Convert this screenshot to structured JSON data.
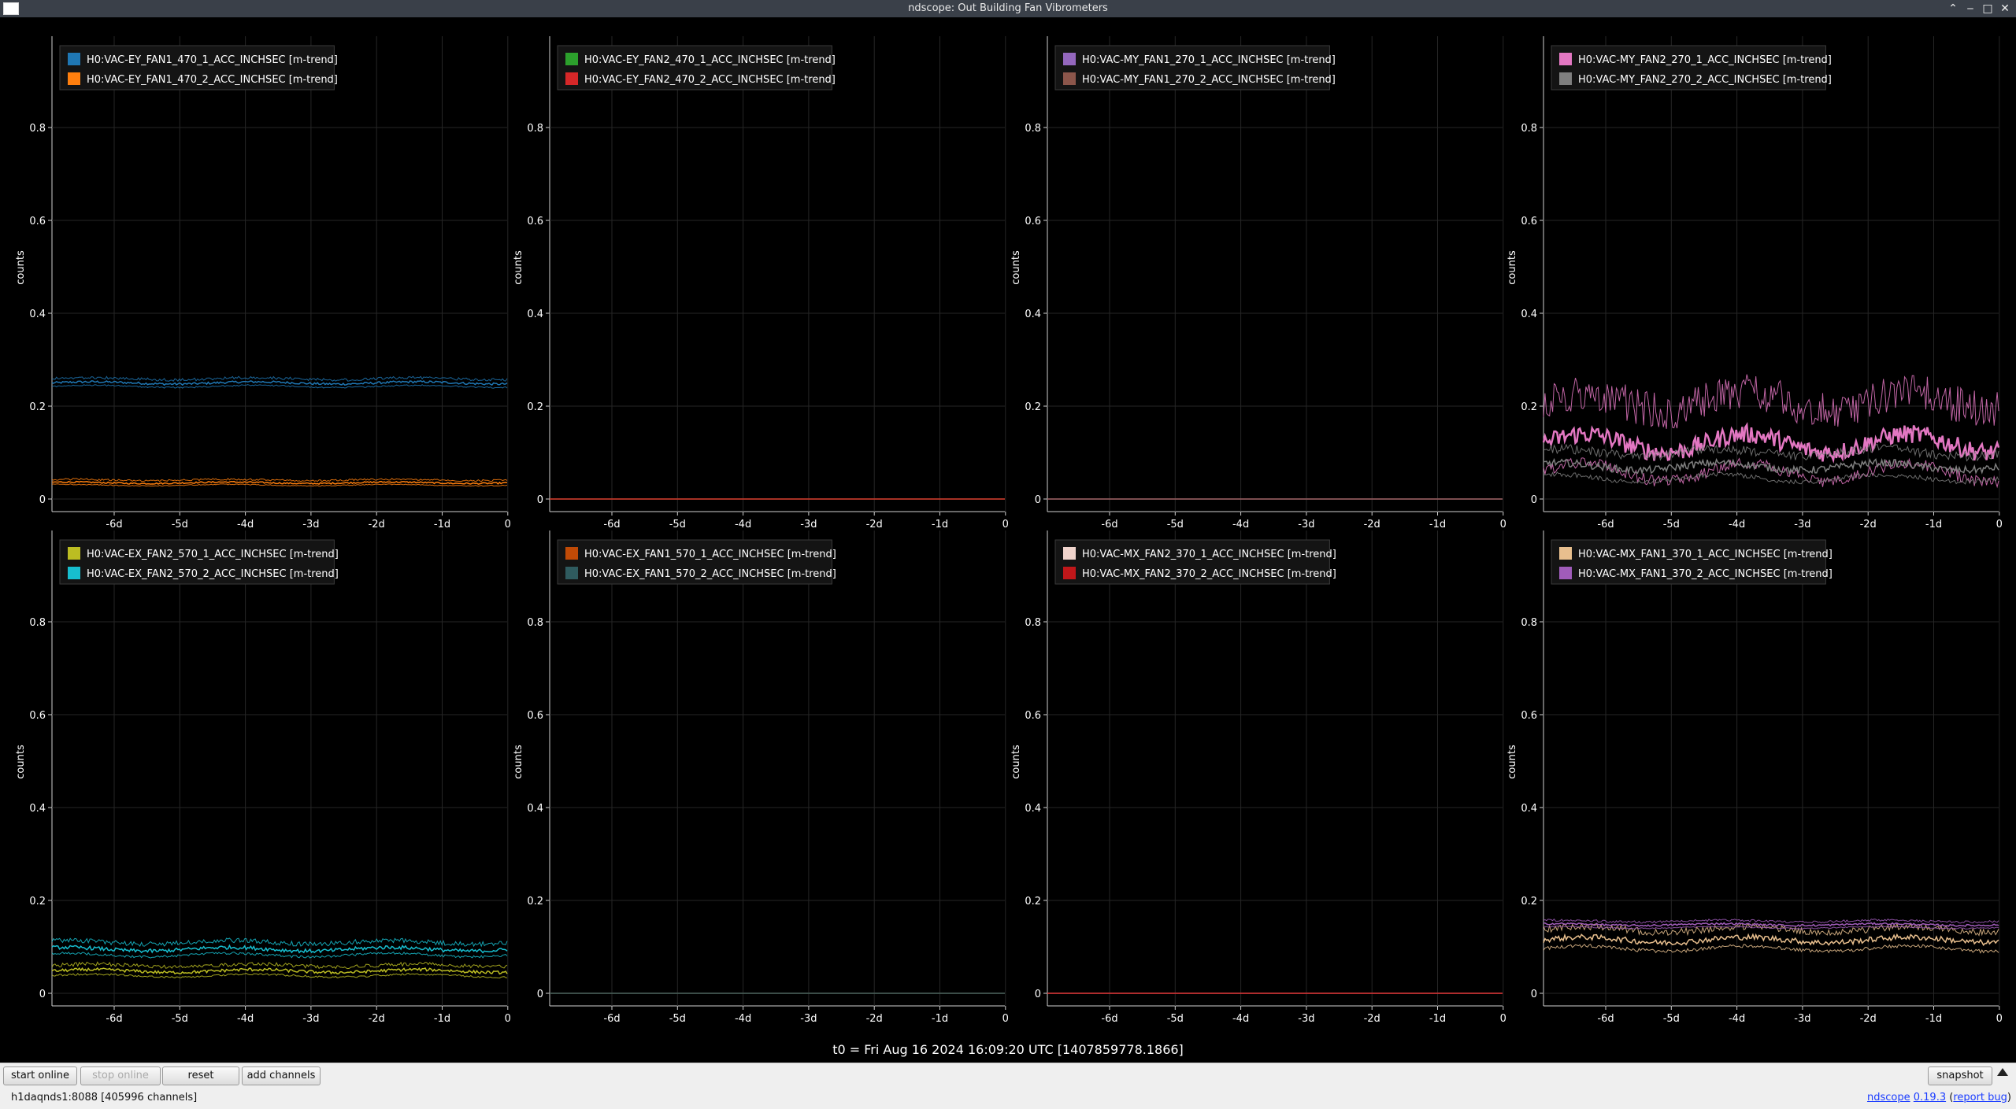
{
  "window": {
    "title": "ndscope: Out Building Fan Vibrometers",
    "controls": [
      "chevron-up-icon",
      "minimize-icon",
      "maximize-icon",
      "close-icon"
    ]
  },
  "t0_label": "t0 = Fri Aug 16 2024 16:09:20 UTC [1407859778.1866]",
  "toolbar": {
    "start_online": "start online",
    "stop_online": "stop online",
    "reset": "reset",
    "add_channels": "add channels",
    "snapshot": "snapshot"
  },
  "status": {
    "server": "h1daqnds1:8088  [405996 channels]",
    "version_link": "ndscope",
    "version": "0.19.3",
    "report_bug": "report bug"
  },
  "chart_data": [
    {
      "type": "line",
      "ylabel": "counts",
      "ylim": [
        0,
        1.0
      ],
      "yticks": [
        "0",
        "0.2",
        "0.4",
        "0.6",
        "0.8"
      ],
      "xticks": [
        "-6d",
        "-5d",
        "-4d",
        "-3d",
        "-2d",
        "-1d",
        "0"
      ],
      "legend_placement": "top-left",
      "grid": true,
      "series": [
        {
          "name": "H0:VAC-EY_FAN1_470_1_ACC_INCHSEC [m-trend]",
          "color": "#1f77b4",
          "mean": 0.25,
          "band": 0.006
        },
        {
          "name": "H0:VAC-EY_FAN1_470_2_ACC_INCHSEC [m-trend]",
          "color": "#ff7f0e",
          "mean": 0.035,
          "band": 0.004
        }
      ]
    },
    {
      "type": "line",
      "ylabel": "counts",
      "ylim": [
        0,
        1.0
      ],
      "yticks": [
        "0",
        "0.2",
        "0.4",
        "0.6",
        "0.8"
      ],
      "xticks": [
        "-6d",
        "-5d",
        "-4d",
        "-3d",
        "-2d",
        "-1d",
        "0"
      ],
      "legend_placement": "top-left",
      "grid": true,
      "series": [
        {
          "name": "H0:VAC-EY_FAN2_470_1_ACC_INCHSEC [m-trend]",
          "color": "#2ca02c",
          "mean": 0.0,
          "band": 0
        },
        {
          "name": "H0:VAC-EY_FAN2_470_2_ACC_INCHSEC [m-trend]",
          "color": "#d62728",
          "mean": 0.0,
          "band": 0
        }
      ]
    },
    {
      "type": "line",
      "ylabel": "counts",
      "ylim": [
        0,
        1.0
      ],
      "yticks": [
        "0",
        "0.2",
        "0.4",
        "0.6",
        "0.8"
      ],
      "xticks": [
        "-6d",
        "-5d",
        "-4d",
        "-3d",
        "-2d",
        "-1d",
        "0"
      ],
      "legend_placement": "top-left",
      "grid": true,
      "series": [
        {
          "name": "H0:VAC-MY_FAN1_270_1_ACC_INCHSEC [m-trend]",
          "color": "#9467bd",
          "mean": 0.0,
          "band": 0
        },
        {
          "name": "H0:VAC-MY_FAN1_270_2_ACC_INCHSEC [m-trend]",
          "color": "#8c564b",
          "mean": 0.0,
          "band": 0
        }
      ]
    },
    {
      "type": "line",
      "ylabel": "counts",
      "ylim": [
        0,
        1.0
      ],
      "yticks": [
        "0",
        "0.2",
        "0.4",
        "0.6",
        "0.8"
      ],
      "xticks": [
        "-6d",
        "-5d",
        "-4d",
        "-3d",
        "-2d",
        "-1d",
        "0"
      ],
      "legend_placement": "top-left",
      "grid": true,
      "series": [
        {
          "name": "H0:VAC-MY_FAN2_270_1_ACC_INCHSEC [m-trend]",
          "color": "#e377c2",
          "mean": 0.12,
          "band": 0.05
        },
        {
          "name": "H0:VAC-MY_FAN2_270_2_ACC_INCHSEC [m-trend]",
          "color": "#7f7f7f",
          "mean": 0.07,
          "band": 0.02
        }
      ]
    },
    {
      "type": "line",
      "ylabel": "counts",
      "ylim": [
        0,
        1.0
      ],
      "yticks": [
        "0",
        "0.2",
        "0.4",
        "0.6",
        "0.8"
      ],
      "xticks": [
        "-6d",
        "-5d",
        "-4d",
        "-3d",
        "-2d",
        "-1d",
        "0"
      ],
      "legend_placement": "top-left",
      "grid": true,
      "series": [
        {
          "name": "H0:VAC-EX_FAN2_570_1_ACC_INCHSEC [m-trend]",
          "color": "#bcbd22",
          "mean": 0.048,
          "band": 0.008
        },
        {
          "name": "H0:VAC-EX_FAN2_570_2_ACC_INCHSEC [m-trend]",
          "color": "#17becf",
          "mean": 0.095,
          "band": 0.01
        }
      ]
    },
    {
      "type": "line",
      "ylabel": "counts",
      "ylim": [
        0,
        1.0
      ],
      "yticks": [
        "0",
        "0.2",
        "0.4",
        "0.6",
        "0.8"
      ],
      "xticks": [
        "-6d",
        "-5d",
        "-4d",
        "-3d",
        "-2d",
        "-1d",
        "0"
      ],
      "legend_placement": "top-left",
      "grid": true,
      "series": [
        {
          "name": "H0:VAC-EX_FAN1_570_1_ACC_INCHSEC [m-trend]",
          "color": "#c04a06",
          "mean": 0.0,
          "band": 0
        },
        {
          "name": "H0:VAC-EX_FAN1_570_2_ACC_INCHSEC [m-trend]",
          "color": "#2f5b5f",
          "mean": 0.0,
          "band": 0
        }
      ]
    },
    {
      "type": "line",
      "ylabel": "counts",
      "ylim": [
        0,
        1.0
      ],
      "yticks": [
        "0",
        "0.2",
        "0.4",
        "0.6",
        "0.8"
      ],
      "xticks": [
        "-6d",
        "-5d",
        "-4d",
        "-3d",
        "-2d",
        "-1d",
        "0"
      ],
      "legend_placement": "top-left",
      "grid": true,
      "series": [
        {
          "name": "H0:VAC-MX_FAN2_370_1_ACC_INCHSEC [m-trend]",
          "color": "#f0d4cc",
          "mean": 0.0,
          "band": 0
        },
        {
          "name": "H0:VAC-MX_FAN2_370_2_ACC_INCHSEC [m-trend]",
          "color": "#c0171a",
          "mean": 0.0,
          "band": 0
        }
      ]
    },
    {
      "type": "line",
      "ylabel": "counts",
      "ylim": [
        0,
        1.0
      ],
      "yticks": [
        "0",
        "0.2",
        "0.4",
        "0.6",
        "0.8"
      ],
      "xticks": [
        "-6d",
        "-5d",
        "-4d",
        "-3d",
        "-2d",
        "-1d",
        "0"
      ],
      "legend_placement": "top-left",
      "grid": true,
      "series": [
        {
          "name": "H0:VAC-MX_FAN1_370_1_ACC_INCHSEC [m-trend]",
          "color": "#e8bf8e",
          "mean": 0.115,
          "band": 0.015
        },
        {
          "name": "H0:VAC-MX_FAN1_370_2_ACC_INCHSEC [m-trend]",
          "color": "#a05cba",
          "mean": 0.148,
          "band": 0.005
        }
      ]
    }
  ]
}
